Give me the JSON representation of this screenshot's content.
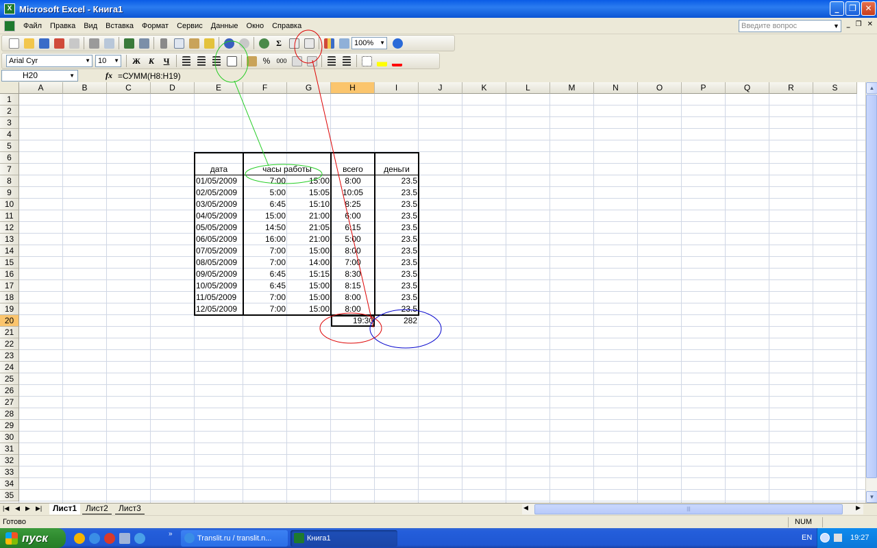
{
  "window": {
    "title": "Microsoft Excel - Книга1",
    "min_glyph": "_",
    "max_glyph": "❐",
    "close_glyph": "✕"
  },
  "menu": {
    "items": [
      "Файл",
      "Правка",
      "Вид",
      "Вставка",
      "Формат",
      "Сервис",
      "Данные",
      "Окно",
      "Справка"
    ],
    "help_placeholder": "Введите вопрос"
  },
  "toolbar": {
    "zoom": "100%",
    "sigma": "Σ"
  },
  "format_toolbar": {
    "font": "Arial Cyr",
    "size": "10",
    "bold": "Ж",
    "italic": "К",
    "underline": "Ч",
    "percent": "%",
    "thousands": "000"
  },
  "formula_bar": {
    "name_box": "H20",
    "fx": "fx",
    "formula": "=СУММ(H8:H19)"
  },
  "columns": [
    "A",
    "B",
    "C",
    "D",
    "E",
    "F",
    "G",
    "H",
    "I",
    "J",
    "K",
    "L",
    "M",
    "N",
    "O",
    "P",
    "Q",
    "R",
    "S"
  ],
  "rows": [
    "1",
    "2",
    "3",
    "4",
    "5",
    "6",
    "7",
    "8",
    "9",
    "10",
    "11",
    "12",
    "13",
    "14",
    "15",
    "16",
    "17",
    "18",
    "19",
    "20",
    "21",
    "22",
    "23",
    "24",
    "25",
    "26",
    "27",
    "28",
    "29",
    "30",
    "31",
    "32",
    "33",
    "34",
    "35"
  ],
  "active_cell": {
    "column": "H",
    "row": "20"
  },
  "table": {
    "headers": {
      "date": "дата",
      "hours": "часы работы",
      "total": "всего",
      "money": "деньги"
    },
    "rows": [
      {
        "date": "01/05/2009",
        "start": "7:00",
        "end": "15:00",
        "total": "8:00",
        "money": "23.5"
      },
      {
        "date": "02/05/2009",
        "start": "5:00",
        "end": "15:05",
        "total": "10:05",
        "money": "23.5"
      },
      {
        "date": "03/05/2009",
        "start": "6:45",
        "end": "15:10",
        "total": "8:25",
        "money": "23.5"
      },
      {
        "date": "04/05/2009",
        "start": "15:00",
        "end": "21:00",
        "total": "6:00",
        "money": "23.5"
      },
      {
        "date": "05/05/2009",
        "start": "14:50",
        "end": "21:05",
        "total": "6:15",
        "money": "23.5"
      },
      {
        "date": "06/05/2009",
        "start": "16:00",
        "end": "21:00",
        "total": "5:00",
        "money": "23.5"
      },
      {
        "date": "07/05/2009",
        "start": "7:00",
        "end": "15:00",
        "total": "8:00",
        "money": "23.5"
      },
      {
        "date": "08/05/2009",
        "start": "7:00",
        "end": "14:00",
        "total": "7:00",
        "money": "23.5"
      },
      {
        "date": "09/05/2009",
        "start": "6:45",
        "end": "15:15",
        "total": "8:30",
        "money": "23.5"
      },
      {
        "date": "10/05/2009",
        "start": "6:45",
        "end": "15:00",
        "total": "8:15",
        "money": "23.5"
      },
      {
        "date": "11/05/2009",
        "start": "7:00",
        "end": "15:00",
        "total": "8:00",
        "money": "23.5"
      },
      {
        "date": "12/05/2009",
        "start": "7:00",
        "end": "15:00",
        "total": "8:00",
        "money": "23.5"
      }
    ],
    "sum_total": "19:30",
    "sum_money": "282"
  },
  "sheets": [
    "Лист1",
    "Лист2",
    "Лист3"
  ],
  "status": {
    "text": "Готово",
    "num": "NUM"
  },
  "taskbar": {
    "start": "пуск",
    "tasks": [
      "Translit.ru / translit.n...",
      "Книга1"
    ],
    "lang": "EN",
    "clock": "19:27"
  },
  "colors": {
    "annotation_green": "#22cc22",
    "annotation_red": "#dd0000",
    "annotation_blue": "#0000cc",
    "active_header": "#fbc56d"
  }
}
